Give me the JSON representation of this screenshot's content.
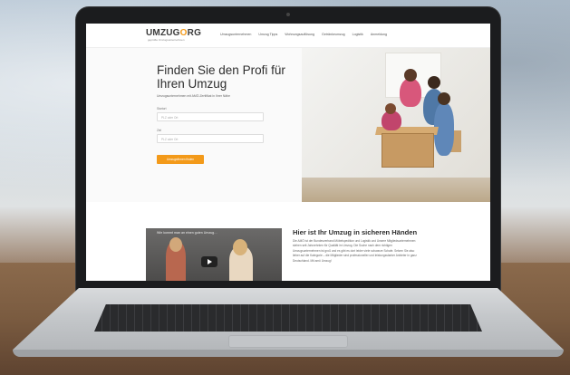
{
  "site": {
    "logo_main": "UMZUG",
    "logo_o": "O",
    "logo_end": "RG",
    "logo_sub": "geprüfte Umzugsunternehmen"
  },
  "nav": {
    "items": [
      "Umzugsunternehmen",
      "Umzug Tipps",
      "Wohnungsauflösung",
      "Getränkeumzug",
      "Logistik",
      "Anmeldung"
    ]
  },
  "hero": {
    "title": "Finden Sie den Profi für Ihren Umzug",
    "subtitle": "Umzugsunternehmen mit AMÖ-Zertifikat in Ihrer Nähe",
    "from_label": "Startort",
    "from_placeholder": "PLZ oder Ort",
    "to_label": "Ziel",
    "to_placeholder": "PLZ oder Ort",
    "cta_label": "Umzugsfirmen finden"
  },
  "video": {
    "title": "Wie kommt man an einen guten Umzug…"
  },
  "section": {
    "title": "Hier ist Ihr Umzug in sicheren Händen",
    "text": "Die AMÖ ist der Bundesverband Möbelspedition und Logistik und Unsere Mitgliedsunternehmen stehen seit Jahrzehnten für Qualität im Umzug. Die Suche nach dem richtigen Umzugsunternehmen ist groß und es gibt es dort leider viele schwarze Schafe. Setzen Sie also lieber auf die Kategorie – die Mitglieder sind professioneller und leistungsstarker Anbieter in ganz Deutschland. Mit amö Umzug!"
  },
  "colors": {
    "accent": "#f39a1a",
    "text_dark": "#2d2d2d"
  }
}
